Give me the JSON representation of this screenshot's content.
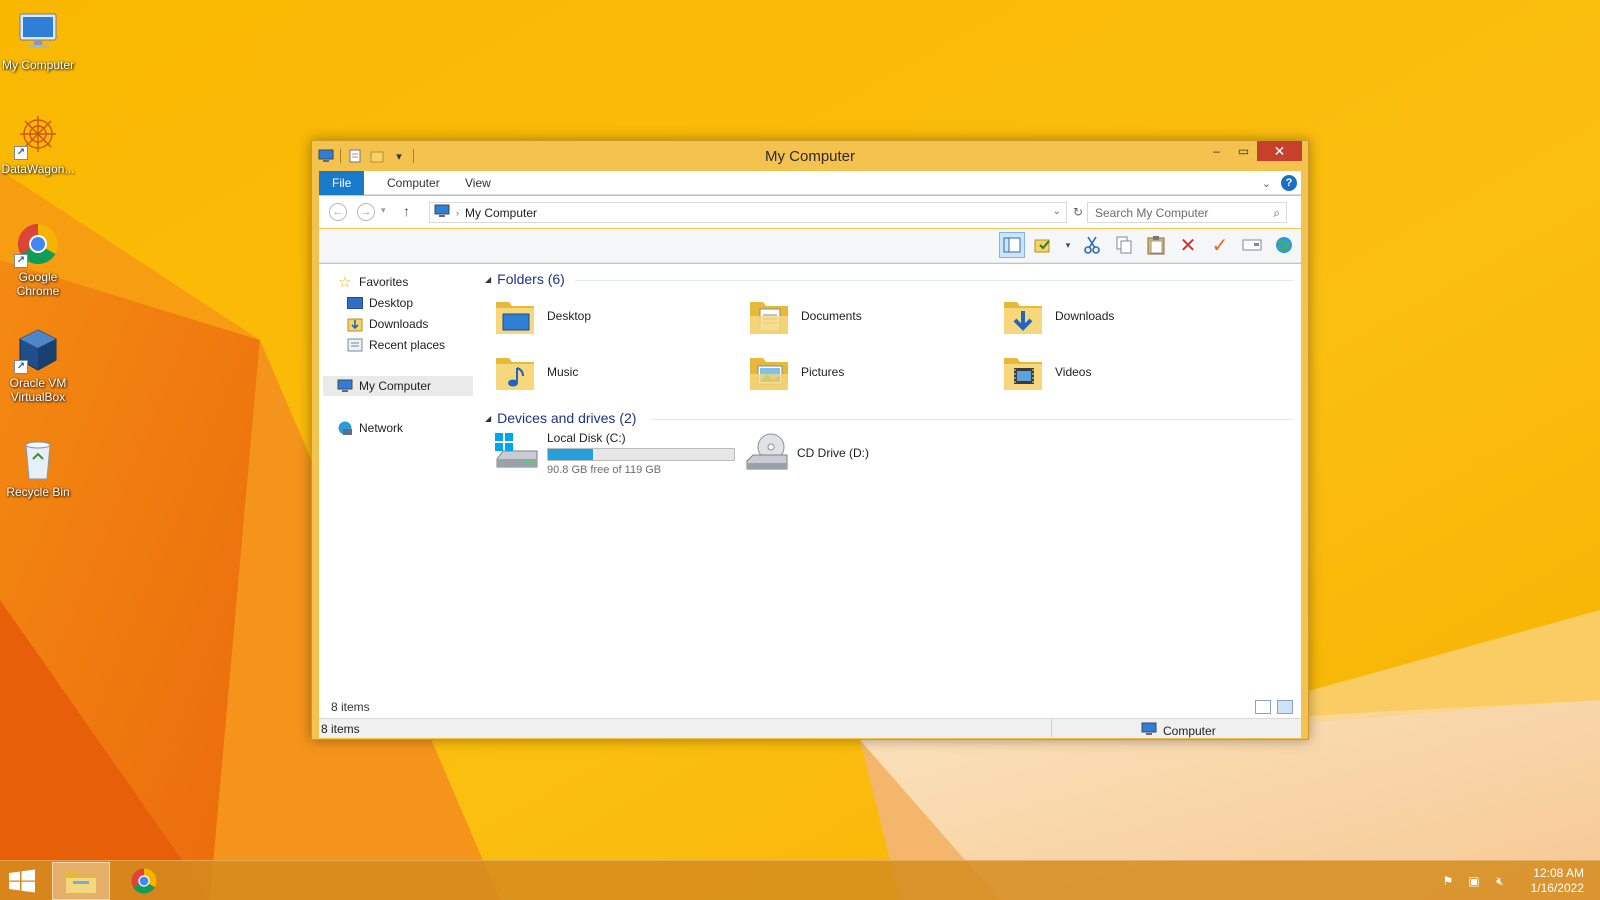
{
  "desktop": {
    "icons": [
      {
        "label": "My Computer"
      },
      {
        "label": "DataWagon..."
      },
      {
        "label": "Google Chrome"
      },
      {
        "label": "Oracle VM VirtualBox"
      },
      {
        "label": "Recycle Bin"
      }
    ]
  },
  "window": {
    "title": "My Computer",
    "ribbon_tabs": [
      "File",
      "Computer",
      "View"
    ],
    "address": {
      "path": "My Computer",
      "search_placeholder": "Search My Computer"
    },
    "nav": {
      "favorites": "Favorites",
      "desktop": "Desktop",
      "downloads": "Downloads",
      "recent": "Recent places",
      "my_computer": "My Computer",
      "network": "Network"
    },
    "folders_heading": "Folders (6)",
    "folders": [
      {
        "name": "Desktop",
        "icon": "desktop-folder-icon"
      },
      {
        "name": "Documents",
        "icon": "documents-folder-icon"
      },
      {
        "name": "Downloads",
        "icon": "downloads-folder-icon"
      },
      {
        "name": "Music",
        "icon": "music-folder-icon"
      },
      {
        "name": "Pictures",
        "icon": "pictures-folder-icon"
      },
      {
        "name": "Videos",
        "icon": "videos-folder-icon"
      }
    ],
    "devices_heading": "Devices and drives (2)",
    "drives": [
      {
        "name": "Local Disk (C:)",
        "free_text": "90.8 GB free of 119 GB",
        "used_fraction": 0.24
      },
      {
        "name": "CD Drive (D:)"
      }
    ],
    "item_count": "8 items",
    "status_left": "8 items",
    "status_right": "Computer"
  },
  "taskbar": {
    "time": "12:08 AM",
    "date": "1/16/2022"
  },
  "colors": {
    "accent": "#1979ca",
    "close": "#c7402c",
    "drive_fill": "#26a0da",
    "window_frame": "#f3c24f"
  }
}
